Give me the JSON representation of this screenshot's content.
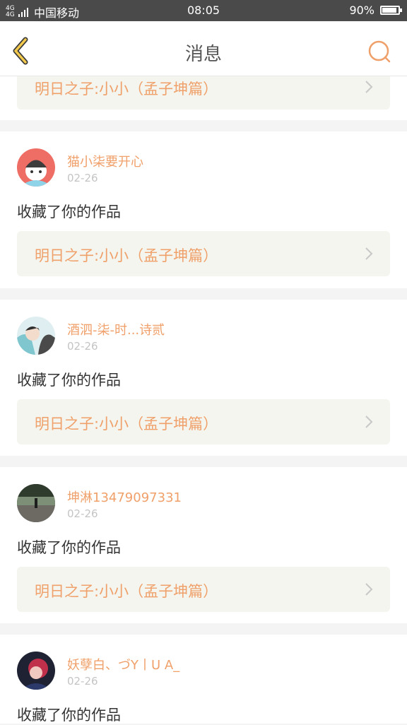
{
  "status_bar": {
    "network_label": "4G 4G",
    "carrier": "中国移动",
    "time": "08:05",
    "battery_percent": "90%",
    "battery_level": 0.9
  },
  "nav": {
    "title": "消息",
    "back_icon": "back-chevron-icon",
    "search_icon": "search-icon",
    "accent_color": "#f0a06a"
  },
  "messages": [
    {
      "work_title": "明日之子:小小（孟子坤篇）"
    },
    {
      "username": "猫小柒要开心",
      "date": "02-26",
      "action": "收藏了你的作品",
      "work_title": "明日之子:小小（孟子坤篇）"
    },
    {
      "username": "酒泗-柒-时...诗贰",
      "date": "02-26",
      "action": "收藏了你的作品",
      "work_title": "明日之子:小小（孟子坤篇）"
    },
    {
      "username": "坤淋13479097331",
      "date": "02-26",
      "action": "收藏了你的作品",
      "work_title": "明日之子:小小（孟子坤篇）"
    },
    {
      "username": "妖孽白、づY丨U A_",
      "date": "02-26",
      "action": "收藏了你的作品"
    }
  ]
}
